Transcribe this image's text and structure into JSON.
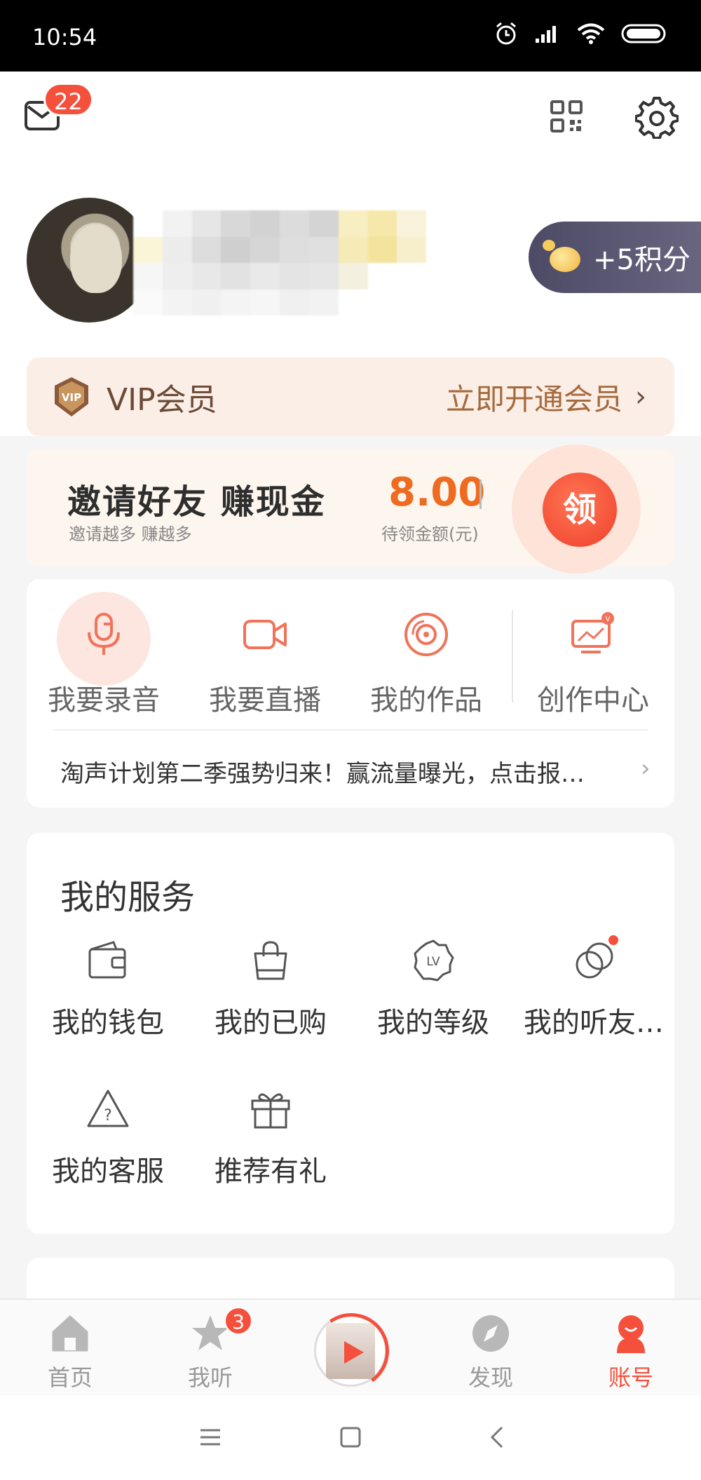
{
  "status_bar": {
    "time": "10:54"
  },
  "header": {
    "mail_badge": "22",
    "points_label": "+5积分"
  },
  "vip": {
    "title": "VIP会员",
    "cta": "立即开通会员",
    "chevron": "›"
  },
  "invite": {
    "title": "邀请好友 赚现金",
    "subtitle": "邀请越多 赚越多",
    "amount": "8.00",
    "amount_label": "待领金额(元)",
    "claim": "领"
  },
  "create": {
    "items": [
      {
        "label": "我要录音",
        "icon": "microphone-icon"
      },
      {
        "label": "我要直播",
        "icon": "video-camera-icon"
      },
      {
        "label": "我的作品",
        "icon": "disc-icon"
      },
      {
        "label": "创作中心",
        "icon": "creator-monitor-icon"
      }
    ],
    "promo": "淘声计划第二季强势归来！赢流量曝光，点击报…",
    "promo_chevron": "›"
  },
  "services": {
    "title": "我的服务",
    "items": [
      {
        "label": "我的钱包",
        "icon": "wallet-icon"
      },
      {
        "label": "我的已购",
        "icon": "shopping-bag-icon"
      },
      {
        "label": "我的等级",
        "icon": "level-badge-icon"
      },
      {
        "label": "我的听友…",
        "icon": "friends-circles-icon"
      },
      {
        "label": "我的客服",
        "icon": "help-triangle-icon"
      },
      {
        "label": "推荐有礼",
        "icon": "gift-icon"
      }
    ]
  },
  "tabbar": {
    "tabs": [
      {
        "label": "首页",
        "icon": "home-icon"
      },
      {
        "label": "我听",
        "icon": "star-icon",
        "badge": "3"
      },
      {
        "label": "",
        "icon": "player-icon"
      },
      {
        "label": "发现",
        "icon": "compass-icon"
      },
      {
        "label": "账号",
        "icon": "account-icon"
      }
    ],
    "active": "账号"
  },
  "colors": {
    "accent": "#f4503c",
    "vip_text": "#6b4a36",
    "amount": "#ef6b20"
  }
}
